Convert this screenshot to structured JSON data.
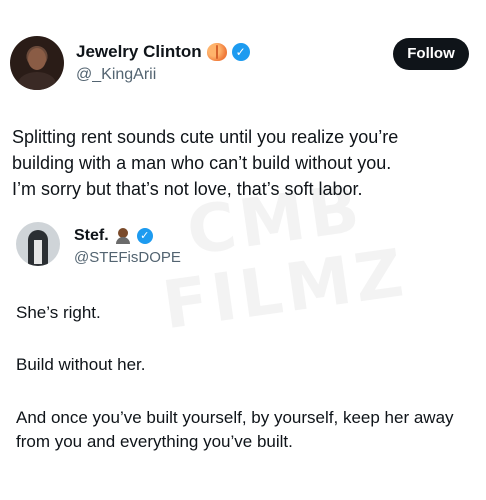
{
  "tweet": {
    "author_name": "Jewelry Clinton",
    "author_handle": "@_KingArii",
    "follow_label": "Follow",
    "text_lines": [
      "Splitting rent sounds cute until you realize you’re",
      "building with a man who can’t build without you.",
      "I’m sorry but that’s not love, that’s soft labor."
    ],
    "name_emoji": "peach-emoji",
    "verified_icon": "verified-badge-icon"
  },
  "quoted_tweet": {
    "author_name": "Stef.",
    "author_handle": "@STEFisDOPE",
    "name_emoji": "person-emoji",
    "verified_icon": "verified-badge-icon",
    "paragraphs": [
      "She’s right.",
      "Build without her.",
      "And once you’ve built yourself, by yourself, keep her away from you and everything you’ve built."
    ]
  },
  "watermark": {
    "lines": [
      "CMB",
      "FILMZ"
    ]
  },
  "colors": {
    "text": "#0f1419",
    "secondary": "#536471",
    "verified": "#1d9bf0",
    "button": "#0f1419"
  }
}
